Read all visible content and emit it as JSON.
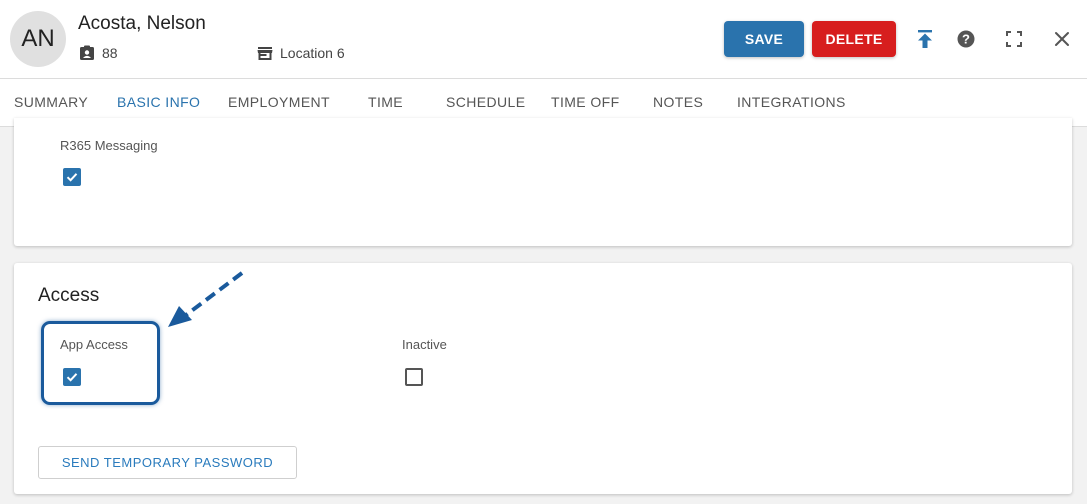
{
  "header": {
    "avatar_initials": "AN",
    "employee_name": "Acosta, Nelson",
    "employee_id": "88",
    "location": "Location 6",
    "save_label": "SAVE",
    "delete_label": "DELETE"
  },
  "tabs": [
    {
      "label": "SUMMARY"
    },
    {
      "label": "BASIC INFO",
      "active": true
    },
    {
      "label": "EMPLOYMENT"
    },
    {
      "label": "TIME"
    },
    {
      "label": "SCHEDULE"
    },
    {
      "label": "TIME OFF"
    },
    {
      "label": "NOTES"
    },
    {
      "label": "INTEGRATIONS"
    }
  ],
  "messaging": {
    "label": "R365 Messaging",
    "checked": true
  },
  "access": {
    "title": "Access",
    "app_access_label": "App Access",
    "app_access_checked": true,
    "inactive_label": "Inactive",
    "inactive_checked": false,
    "send_password_label": "SEND TEMPORARY PASSWORD"
  },
  "colors": {
    "primary": "#2a73ad",
    "danger": "#d71e1e",
    "highlight": "#1a5a9c"
  }
}
